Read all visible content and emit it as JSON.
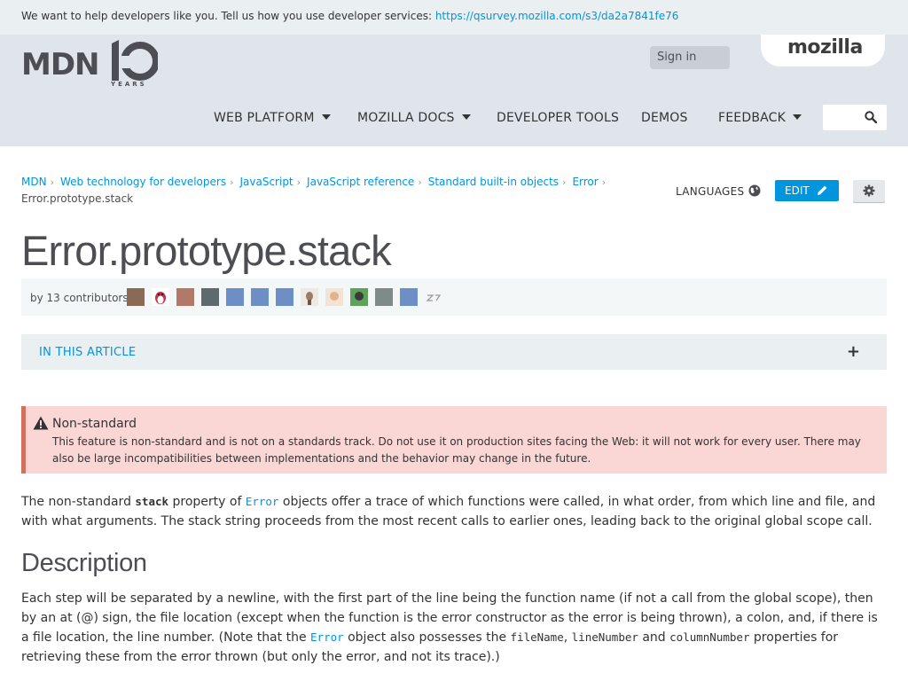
{
  "survey": {
    "text": "We want to help developers like you. Tell us how you use developer services: ",
    "link": "https://qsurvey.mozilla.com/s3/da2a7841fe76"
  },
  "header": {
    "logo_text": "MDN",
    "logo_years": "YEARS",
    "sign_in": "Sign in",
    "mozilla": "mozilla",
    "nav": [
      {
        "label": "WEB PLATFORM",
        "has_caret": true
      },
      {
        "label": "MOZILLA DOCS",
        "has_caret": true
      },
      {
        "label": "DEVELOPER TOOLS",
        "has_caret": false
      },
      {
        "label": "DEMOS",
        "has_caret": false
      },
      {
        "label": "FEEDBACK",
        "has_caret": true
      }
    ],
    "search_icon": "search-icon"
  },
  "breadcrumbs": {
    "items": [
      "MDN",
      "Web technology for developers",
      "JavaScript",
      "JavaScript reference",
      "Standard built-in objects",
      "Error"
    ],
    "current": "Error.prototype.stack"
  },
  "page_actions": {
    "languages": "LANGUAGES",
    "edit": "EDIT"
  },
  "article": {
    "title": "Error.prototype.stack",
    "contributors_label": "by 13 contributors:",
    "in_this_article": "IN THIS ARTICLE",
    "toc_toggle": "+"
  },
  "warning": {
    "title": "Non-standard",
    "text": "This feature is non-standard and is not on a standards track. Do not use it on production sites facing the Web: it will not work for every user. There may also be large incompatibilities between implementations and the behavior may change in the future."
  },
  "intro": {
    "p1_a": "The non-standard ",
    "p1_code": "stack",
    "p1_b": " property of ",
    "p1_link": "Error",
    "p1_c": " objects offer a trace of which functions were called, in what order, from which line and file, and with what arguments. The stack string proceeds from the most recent calls to earlier ones, leading back to the original global scope call."
  },
  "description": {
    "heading": "Description",
    "p_a": "Each step will be separated by a newline, with the first part of the line being the function name (if not a call from the global scope), then by an at (@) sign, the file location (except when the function is the error constructor as the error is being thrown), a colon, and, if there is a file location, the line number. (Note that the ",
    "p_link": "Error",
    "p_b": " object also possesses the ",
    "p_code1": "fileName",
    "p_sep1": ", ",
    "p_code2": "lineNumber",
    "p_and": " and ",
    "p_code3": "columnNumber",
    "p_c": " properties for retrieving these from the error thrown (but only the error, and not its trace).)"
  },
  "colors": {
    "link": "#0095dd",
    "header_bg": "#dfe5ea",
    "warning_bg": "#fad7d5",
    "warning_border": "#d4715e",
    "edit_bg": "#0095dd"
  }
}
